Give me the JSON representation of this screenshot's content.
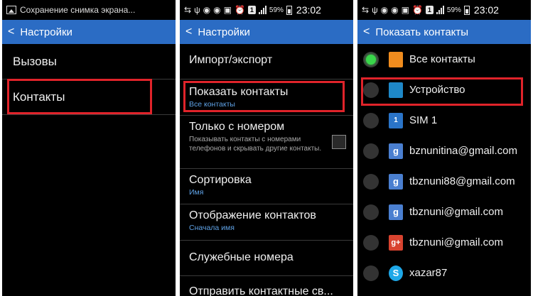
{
  "screen1": {
    "status_text": "Сохранение снимка экрана...",
    "back_glyph": "<",
    "title": "Настройки",
    "items": [
      {
        "label": "Вызовы"
      },
      {
        "label": "Контакты"
      }
    ]
  },
  "screen2": {
    "status": {
      "badge": "1",
      "battery": "59%",
      "time": "23:02"
    },
    "back_glyph": "<",
    "title": "Настройки",
    "items": [
      {
        "label": "Импорт/экспорт"
      },
      {
        "label": "Показать контакты",
        "sub": "Все контакты"
      },
      {
        "label": "Только с номером",
        "desc": "Показывать контакты с номерами телефонов и скрывать другие контакты."
      },
      {
        "label": "Сортировка",
        "sub": "Имя"
      },
      {
        "label": "Отображение контактов",
        "sub": "Сначала имя"
      },
      {
        "label": "Служебные номера"
      },
      {
        "label": "Отправить контактные св..."
      }
    ]
  },
  "screen3": {
    "status": {
      "badge": "1",
      "battery": "59%",
      "time": "23:02"
    },
    "back_glyph": "<",
    "title": "Показать контакты",
    "items": [
      {
        "label": "Все контакты",
        "icon": "contact-card-icon",
        "icon_glyph": "",
        "selected": true
      },
      {
        "label": "Устройство",
        "icon": "phone-device-icon",
        "icon_glyph": ""
      },
      {
        "label": "SIM 1",
        "icon": "sim-card-icon",
        "icon_glyph": "1"
      },
      {
        "label": "bznunitina@gmail.com",
        "icon": "google-icon",
        "icon_glyph": "g"
      },
      {
        "label": "tbznuni88@gmail.com",
        "icon": "google-icon",
        "icon_glyph": "g"
      },
      {
        "label": "tbznuni@gmail.com",
        "icon": "google-icon",
        "icon_glyph": "g"
      },
      {
        "label": "tbznuni@gmail.com",
        "icon": "google-plus-icon",
        "icon_glyph": "g+"
      },
      {
        "label": "xazar87",
        "icon": "skype-icon",
        "icon_glyph": "S"
      }
    ]
  },
  "colors": {
    "action_bar": "#2b6cc4",
    "highlight": "#e0232a",
    "subtext": "#5fa2e6",
    "radio_selected": "#39d64a"
  }
}
